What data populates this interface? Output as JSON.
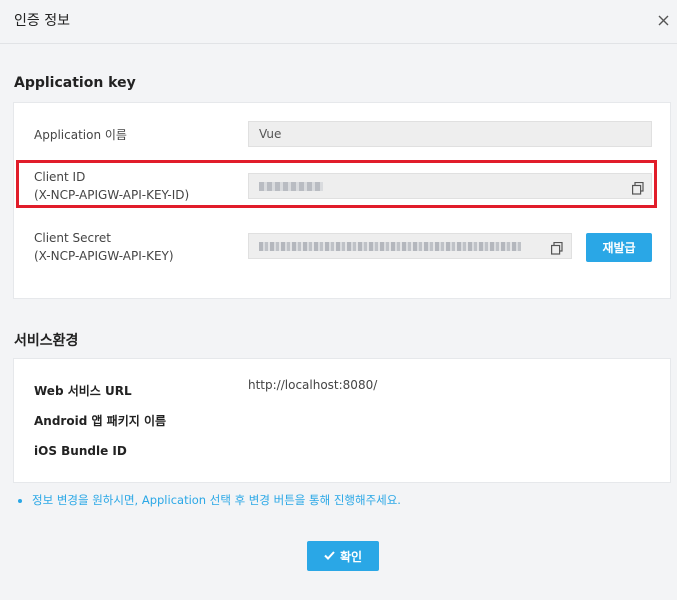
{
  "dialog": {
    "title": "인증 정보",
    "close_icon": "close-icon"
  },
  "application_key": {
    "section_title": "Application key",
    "app_name_label": "Application 이름",
    "app_name_value": "Vue",
    "client_id_label_line1": "Client ID",
    "client_id_label_line2": "(X-NCP-APIGW-API-KEY-ID)",
    "client_secret_label_line1": "Client Secret",
    "client_secret_label_line2": "(X-NCP-APIGW-API-KEY)",
    "reissue_button": "재발급",
    "highlight_color": "#e11d2a"
  },
  "service_env": {
    "section_title": "서비스환경",
    "web_url_label": "Web 서비스 URL",
    "web_url_value": "http://localhost:8080/",
    "android_label": "Android 앱 패키지 이름",
    "ios_label": "iOS Bundle ID"
  },
  "notice": "정보 변경을 원하시면, Application 선택 후 변경 버튼을 통해 진행해주세요.",
  "confirm_button": "확인",
  "colors": {
    "accent": "#2aa7e6",
    "highlight": "#e11d2a"
  }
}
